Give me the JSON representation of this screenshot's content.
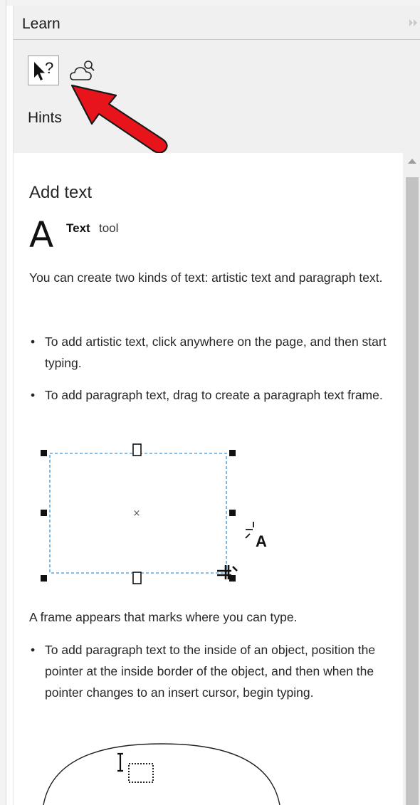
{
  "panel": {
    "title": "Learn",
    "tools": [
      {
        "name": "hints",
        "icon": "pointer-question-icon",
        "active": true
      },
      {
        "name": "cloud-search",
        "icon": "cloud-search-icon",
        "active": false
      }
    ],
    "section_label": "Hints"
  },
  "content": {
    "heading": "Add text",
    "tool_glyph": "A",
    "tool_name": "Text",
    "tool_suffix": "tool",
    "intro": "You can create two kinds of text: artistic text and paragraph text.",
    "bullets_1": [
      "To add artistic text, click anywhere on the page, and then start typing.",
      "To add paragraph text, drag to create a paragraph text frame."
    ],
    "frame_caption": "A frame appears that marks where you can type.",
    "bullets_2": [
      "To add paragraph text to the inside of an object, position the pointer at the inside border of the object, and then when the pointer changes to an insert cursor, begin typing."
    ],
    "bullet_char": "•",
    "figure_cursor_letter": "A"
  },
  "colors": {
    "arrow": "#e8141c",
    "frame_dash": "#5aa8e6",
    "scroll_thumb": "#c2c2c2"
  }
}
